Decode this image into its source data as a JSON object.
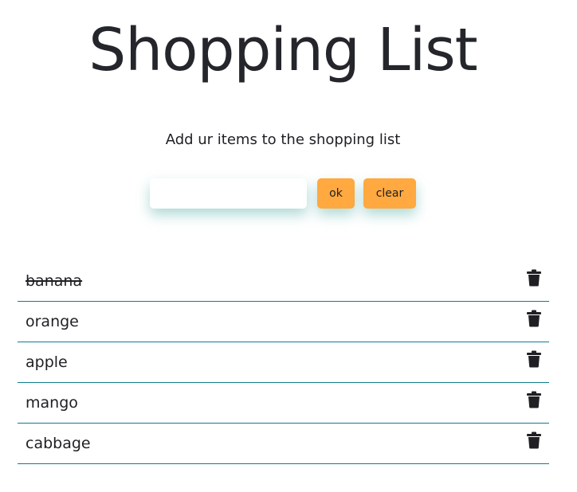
{
  "header": {
    "title": "Shopping List",
    "subtitle": "Add ur items to the shopping list"
  },
  "form": {
    "input_value": "",
    "ok_label": "ok",
    "clear_label": "clear"
  },
  "items": [
    {
      "label": "banana",
      "done": true,
      "icon": "trash-icon"
    },
    {
      "label": "orange",
      "done": false,
      "icon": "trash-icon"
    },
    {
      "label": "apple",
      "done": false,
      "icon": "trash-icon"
    },
    {
      "label": "mango",
      "done": false,
      "icon": "trash-icon"
    },
    {
      "label": "cabbage",
      "done": false,
      "icon": "trash-icon"
    }
  ],
  "colors": {
    "accent": "#ffa940",
    "divider": "#0c7e8c",
    "text": "#1f1f24",
    "shadow": "#1f968c"
  }
}
